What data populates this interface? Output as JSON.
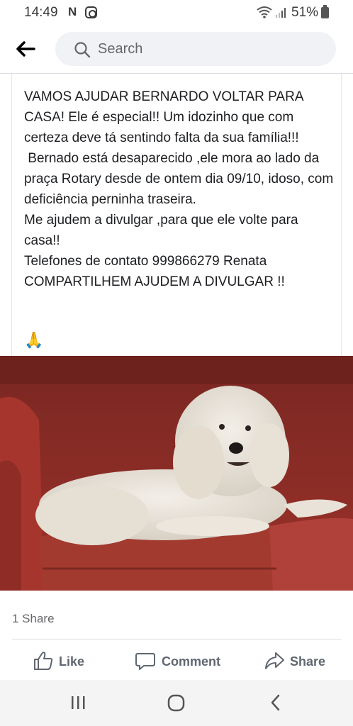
{
  "status_bar": {
    "time": "14:49",
    "notification_letter": "N",
    "battery_percent": "51%",
    "icons": [
      "instagram-icon",
      "wifi-icon",
      "signal-icon",
      "battery-icon"
    ]
  },
  "header": {
    "back_icon": "arrow-left-icon",
    "search_placeholder": "Search"
  },
  "post": {
    "text": "VAMOS AJUDAR BERNARDO VOLTAR PARA CASA! Ele é especial!! Um idozinho que com certeza deve tá sentindo falta da sua família!!!\n Bernado está desaparecido ,ele mora ao lado da praça Rotary desde de ontem dia 09/10, idoso, com deficiência perninha traseira.\nMe ajudem a divulgar ,para que ele volte para casa!!\nTelefones de contato 999866279 Renata\nCOMPARTILHEM AJUDEM A DIVULGAR !!",
    "emoji": "🙏",
    "photo_subject": "white-poodle-on-red-sofa"
  },
  "engagement": {
    "share_count": "1 Share",
    "actions": {
      "like": "Like",
      "comment": "Comment",
      "share": "Share"
    }
  },
  "colors": {
    "accent_text": "#606770",
    "secondary_text": "#65676b",
    "search_bg": "#f0f2f5",
    "sofa_red": "#8b2b25"
  },
  "nav_bar": {
    "icons": [
      "recent-apps-icon",
      "home-icon",
      "back-icon"
    ]
  }
}
